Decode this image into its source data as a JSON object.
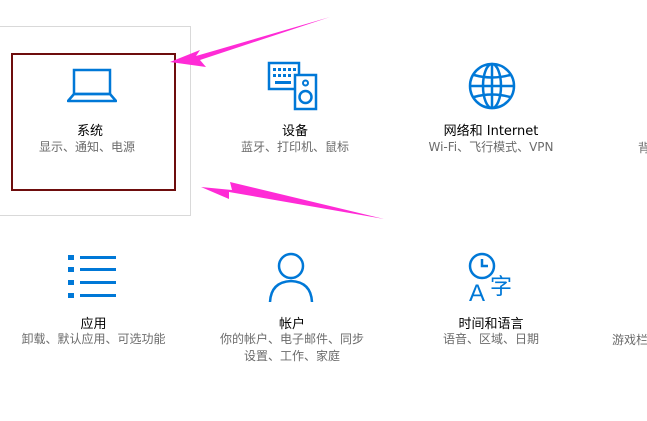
{
  "tiles": {
    "system": {
      "title": "系统",
      "desc": "显示、通知、电源"
    },
    "devices": {
      "title": "设备",
      "desc": "蓝牙、打印机、鼠标"
    },
    "network": {
      "title": "网络和 Internet",
      "desc": "Wi-Fi、飞行模式、VPN"
    },
    "apps": {
      "title": "应用",
      "desc": "卸载、默认应用、可选功能"
    },
    "accounts": {
      "title": "帐户",
      "desc_line1": "你的帐户、电子邮件、同步",
      "desc_line2": "设置、工作、家庭"
    },
    "time": {
      "title": "时间和语言",
      "desc": "语音、区域、日期"
    }
  },
  "partial": {
    "right_top": "背",
    "right_bottom": "游戏栏"
  },
  "icon_glyphs": {
    "time_letters": "A字"
  },
  "colors": {
    "accent": "#0078d7",
    "arrow": "#ff2bd6",
    "highlight_border": "#6e0d0d"
  }
}
